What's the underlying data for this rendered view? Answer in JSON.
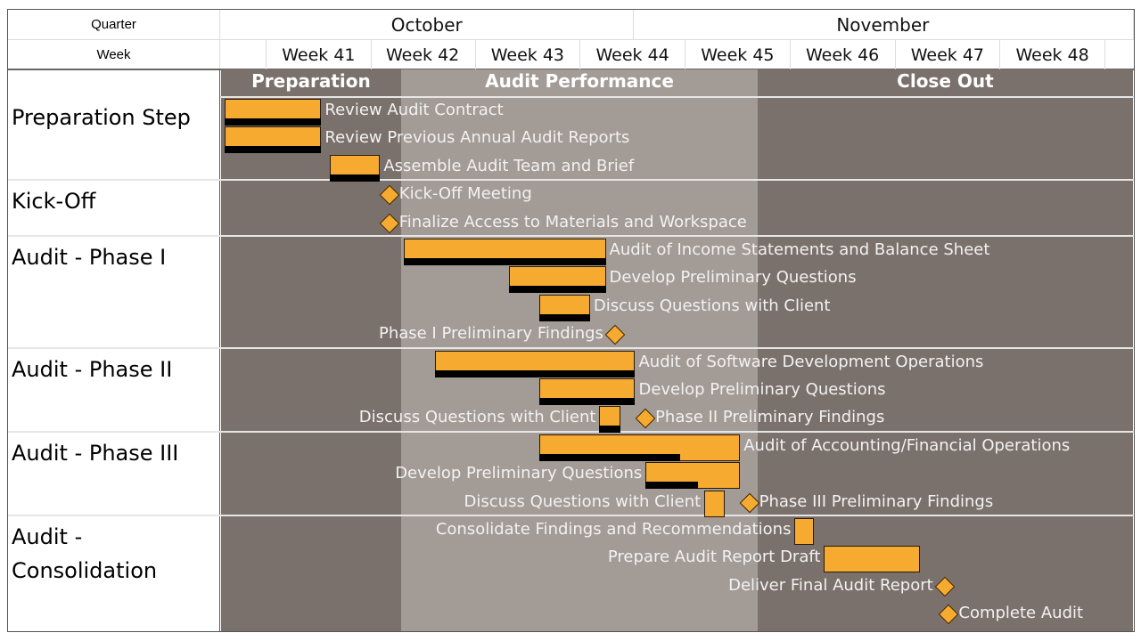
{
  "chart_data": {
    "type": "gantt",
    "header": {
      "quarter_label": "Quarter",
      "week_label": "Week"
    },
    "months": [
      {
        "name": "October",
        "start": 40.57,
        "end": 44.5
      },
      {
        "name": "November",
        "start": 44.5,
        "end": 49.26
      }
    ],
    "weeks": [
      "Week 41",
      "Week 42",
      "Week 43",
      "Week 44",
      "Week 45",
      "Week 46",
      "Week 47",
      "Week 48"
    ],
    "x_range_weeks": [
      40.57,
      49.26
    ],
    "phases": [
      {
        "name": "Preparation",
        "start": 40.57,
        "end": 42.29,
        "color": "#7b716c"
      },
      {
        "name": "Audit Performance",
        "start": 42.29,
        "end": 45.69,
        "color": "#a39b96"
      },
      {
        "name": "Close Out",
        "start": 45.69,
        "end": 49.26,
        "color": "#7b716c"
      }
    ],
    "groups": [
      {
        "name": "Preparation Step",
        "rows": 3
      },
      {
        "name": "Kick-Off",
        "rows": 2
      },
      {
        "name": "Audit -  Phase I",
        "rows": 4
      },
      {
        "name": "Audit - Phase II",
        "rows": 3
      },
      {
        "name": "Audit - Phase III",
        "rows": 3
      },
      {
        "name": "Audit - Consolidation",
        "rows": 4
      }
    ],
    "tasks": [
      {
        "name": "Review Audit Contract",
        "row": 0,
        "start": 40.61,
        "end": 41.53,
        "progress": 100,
        "label": "right"
      },
      {
        "name": "Review Previous Annual Audit Reports",
        "row": 1,
        "start": 40.61,
        "end": 41.53,
        "progress": 100,
        "label": "right"
      },
      {
        "name": "Assemble Audit Team and Brief",
        "row": 2,
        "start": 41.61,
        "end": 42.09,
        "progress": 100,
        "label": "right"
      },
      {
        "name": "Kick-Off Meeting",
        "row": 3,
        "milestone": true,
        "at": 42.17,
        "label": "right"
      },
      {
        "name": "Finalize Access to Materials and Workspace",
        "row": 4,
        "milestone": true,
        "at": 42.17,
        "label": "right"
      },
      {
        "name": "Audit of Income Statements and Balance Sheet",
        "row": 5,
        "start": 42.32,
        "end": 44.24,
        "progress": 100,
        "label": "right"
      },
      {
        "name": "Develop Preliminary Questions",
        "row": 6,
        "start": 43.32,
        "end": 44.24,
        "progress": 100,
        "label": "right"
      },
      {
        "name": "Discuss Questions with Client",
        "row": 7,
        "start": 43.61,
        "end": 44.09,
        "progress": 100,
        "label": "right"
      },
      {
        "name": "Phase I Preliminary Findings",
        "row": 8,
        "milestone": true,
        "at": 44.32,
        "label": "left"
      },
      {
        "name": "Audit of Software Development Operations",
        "row": 9,
        "start": 42.61,
        "end": 44.52,
        "progress": 100,
        "label": "right"
      },
      {
        "name": "Develop Preliminary Questions",
        "row": 10,
        "start": 43.61,
        "end": 44.52,
        "progress": 100,
        "label": "right"
      },
      {
        "name": "Discuss Questions with Client",
        "row": 11,
        "start": 44.18,
        "end": 44.38,
        "progress": 100,
        "label": "left"
      },
      {
        "name": "Phase II Preliminary Findings",
        "row": 11,
        "milestone": true,
        "at": 44.61,
        "label": "right"
      },
      {
        "name": "Audit of Accounting/Financial Operations",
        "row": 12,
        "start": 43.61,
        "end": 45.52,
        "progress": 70,
        "label": "right"
      },
      {
        "name": "Develop Preliminary Questions",
        "row": 13,
        "start": 44.62,
        "end": 45.52,
        "progress": 55,
        "label": "left"
      },
      {
        "name": "Discuss Questions with Client",
        "row": 14,
        "start": 45.18,
        "end": 45.37,
        "progress": 0,
        "label": "left"
      },
      {
        "name": "Phase III Preliminary Findings",
        "row": 14,
        "milestone": true,
        "at": 45.6,
        "label": "right"
      },
      {
        "name": "Consolidate Findings and Recommendations",
        "row": 15,
        "start": 46.04,
        "end": 46.22,
        "progress": 0,
        "label": "left"
      },
      {
        "name": "Prepare Audit Report Draft",
        "row": 16,
        "start": 46.32,
        "end": 47.23,
        "progress": 0,
        "label": "left"
      },
      {
        "name": "Deliver Final Audit Report",
        "row": 17,
        "milestone": true,
        "at": 47.46,
        "label": "left"
      },
      {
        "name": "Complete Audit",
        "row": 18,
        "milestone": true,
        "at": 47.5,
        "label": "right"
      }
    ],
    "colors": {
      "bar": "#f6ab30",
      "progress": "#000000"
    }
  }
}
